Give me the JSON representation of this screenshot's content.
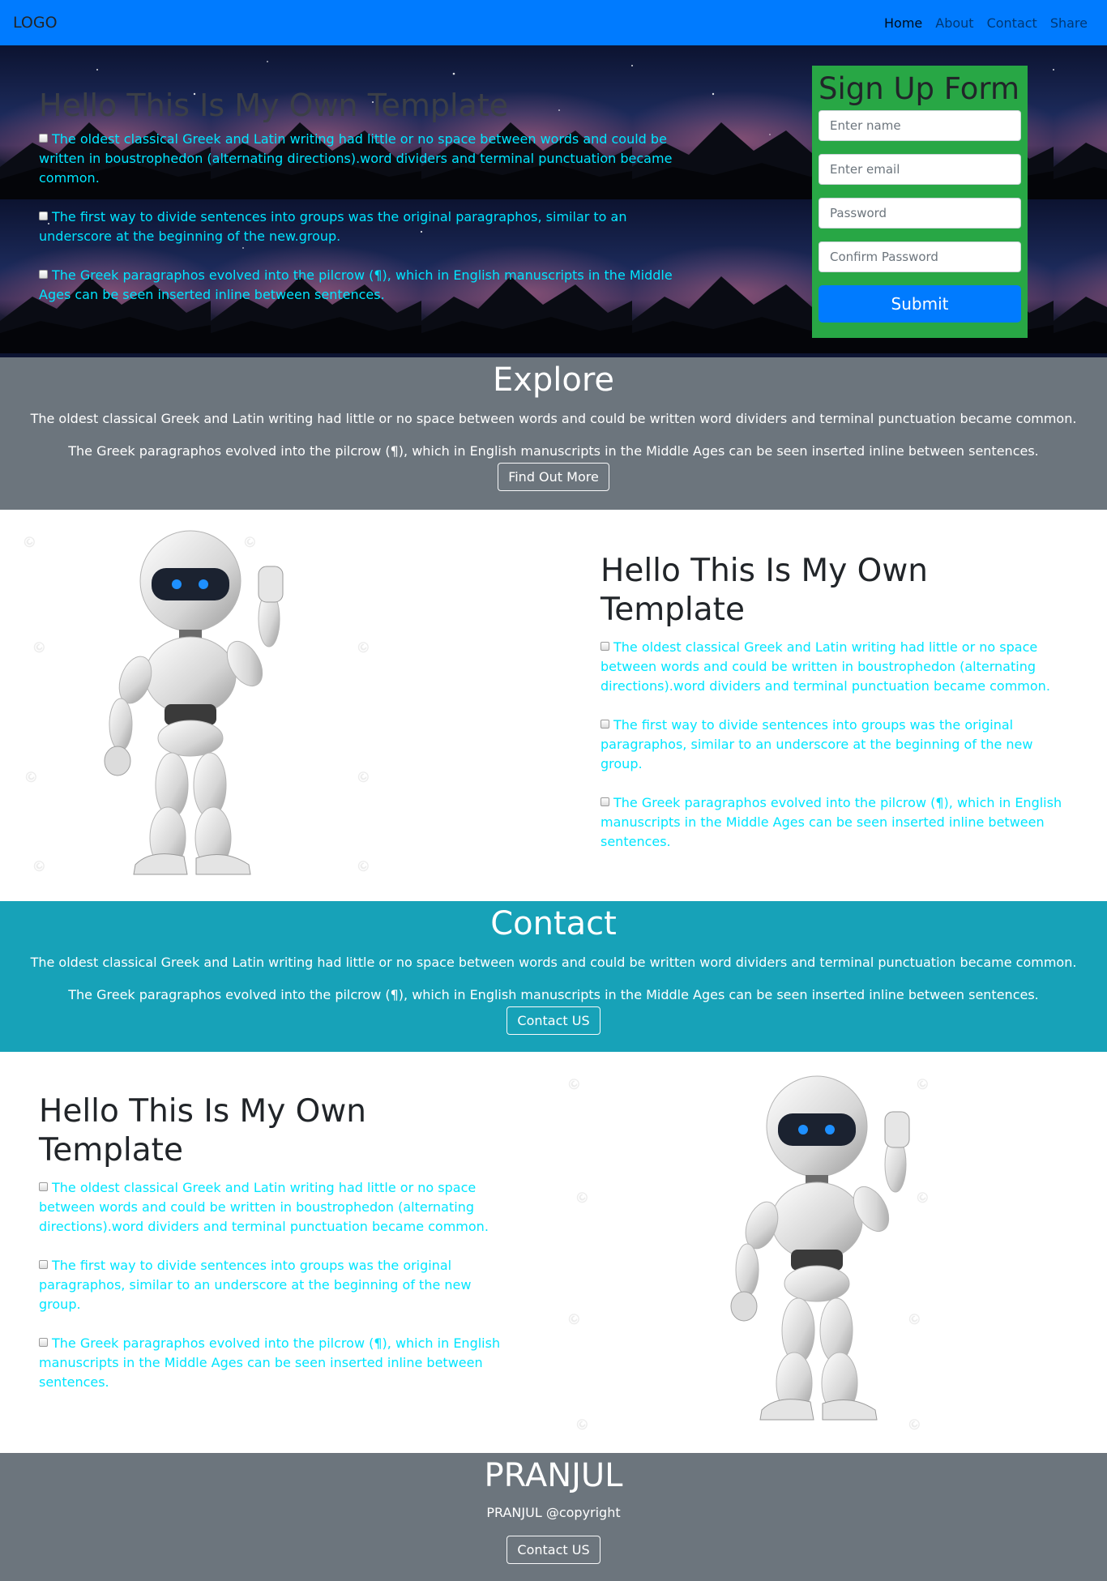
{
  "navbar": {
    "logo": "LOGO",
    "links": [
      "Home",
      "About",
      "Contact",
      "Share"
    ]
  },
  "hero": {
    "title": "Hello This Is My Own Template",
    "paragraphs": [
      "The oldest classical Greek and Latin writing had little or no space between words and could be written in boustrophedon (alternating directions).word dividers and terminal punctuation became common.",
      "The first way to divide sentences into groups was the original paragraphos, similar to an underscore at the beginning of the new.group.",
      "The Greek paragraphos evolved into the pilcrow (¶), which in English manuscripts in the Middle Ages can be seen inserted inline between sentences."
    ]
  },
  "signup": {
    "title": "Sign Up Form",
    "name_placeholder": "Enter name",
    "email_placeholder": "Enter email",
    "password_placeholder": "Password",
    "confirm_placeholder": "Confirm Password",
    "submit_label": "Submit"
  },
  "explore": {
    "title": "Explore",
    "line1": "The oldest classical Greek and Latin writing had little or no space between words and could be written word dividers and terminal punctuation became common.",
    "line2": "The Greek paragraphos evolved into the pilcrow (¶), which in English manuscripts in the Middle Ages can be seen inserted inline between sentences.",
    "button": "Find Out More"
  },
  "feature1": {
    "title": "Hello This Is My Own Template",
    "paragraphs": [
      "The oldest classical Greek and Latin writing had little or no space between words and could be written in boustrophedon (alternating directions).word dividers and terminal punctuation became common.",
      "The first way to divide sentences into groups was the original paragraphos, similar to an underscore at the beginning of the new group.",
      "The Greek paragraphos evolved into the pilcrow (¶), which in English manuscripts in the Middle Ages can be seen inserted inline between sentences."
    ]
  },
  "contact": {
    "title": "Contact",
    "line1": "The oldest classical Greek and Latin writing had little or no space between words and could be written word dividers and terminal punctuation became common.",
    "line2": "The Greek paragraphos evolved into the pilcrow (¶), which in English manuscripts in the Middle Ages can be seen inserted inline between sentences.",
    "button": "Contact US"
  },
  "feature2": {
    "title": "Hello This Is My Own Template",
    "paragraphs": [
      "The oldest classical Greek and Latin writing had little or no space between words and could be written in boustrophedon (alternating directions).word dividers and terminal punctuation became common.",
      "The first way to divide sentences into groups was the original paragraphos, similar to an underscore at the beginning of the new group.",
      "The Greek paragraphos evolved into the pilcrow (¶), which in English manuscripts in the Middle Ages can be seen inserted inline between sentences."
    ]
  },
  "footer": {
    "title": "PRANJUL",
    "copyright": "PRANJUL @copyright",
    "button": "Contact US"
  },
  "colors": {
    "navbar": "#007bff",
    "form_bg": "#28a745",
    "explore_bg": "#6c757d",
    "contact_bg": "#17a2b8",
    "cyan_text": "#00e5ff"
  },
  "icons": [
    "checkbox-icon",
    "robot-image"
  ]
}
